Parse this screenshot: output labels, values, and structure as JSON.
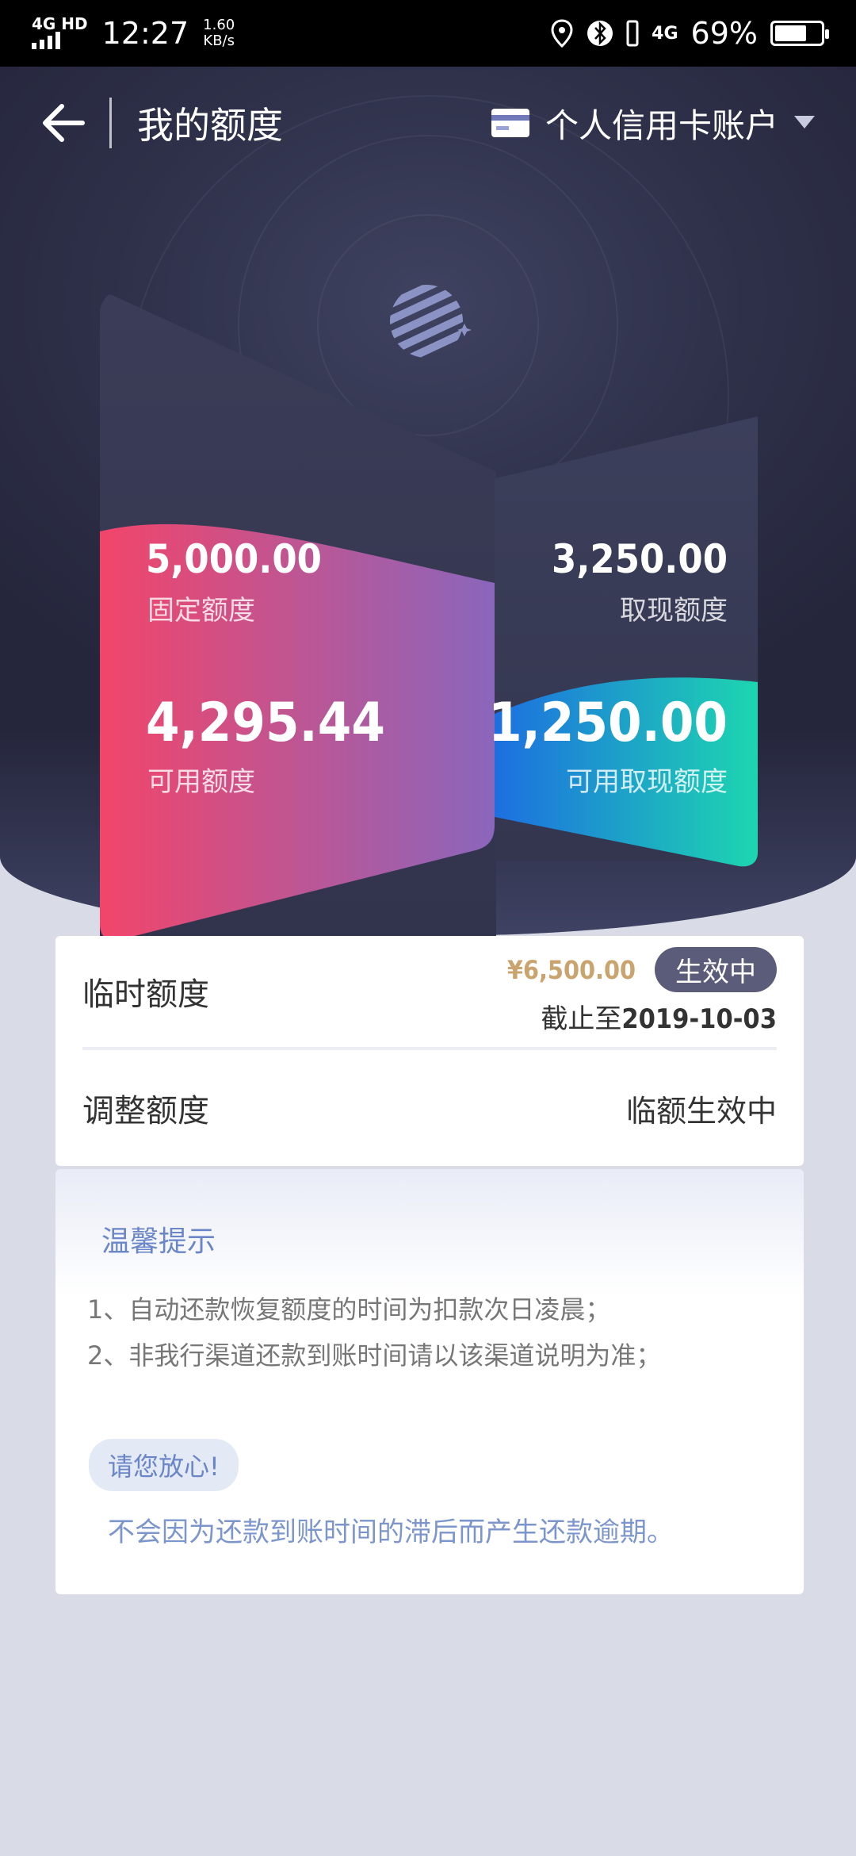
{
  "status_bar": {
    "network": "4G HD",
    "time": "12:27",
    "speed_value": "1.60",
    "speed_unit": "KB/s",
    "mobile": "4G",
    "battery_percent": "69%",
    "battery_level": 0.69
  },
  "nav": {
    "title": "我的额度",
    "account": "个人信用卡账户"
  },
  "limits": {
    "fixed": {
      "amount": "5,000.00",
      "label": "固定额度"
    },
    "available": {
      "amount": "4,295.44",
      "label": "可用额度"
    },
    "cash": {
      "amount": "3,250.00",
      "label": "取现额度"
    },
    "available_cash": {
      "amount": "1,250.00",
      "label": "可用取现额度"
    }
  },
  "temp_limit": {
    "label": "临时额度",
    "amount": "¥6,500.00",
    "status": "生效中",
    "until_prefix": "截止至",
    "until_date": "2019-10-03"
  },
  "adjust": {
    "label": "调整额度",
    "status": "临额生效中"
  },
  "tips": {
    "title": "温馨提示",
    "items": [
      "1、自动还款恢复额度的时间为扣款次日凌晨；",
      "2、非我行渠道还款到账时间请以该渠道说明为准；"
    ],
    "reassure_badge": "请您放心!",
    "reassure_text": "不会因为还款到账时间的滞后而产生还款逾期。"
  },
  "colors": {
    "hero_dark": "#2e3049",
    "pink": "#f2456a",
    "purple": "#8a66bc",
    "blue": "#1d7fe0",
    "teal": "#1dd6b0",
    "gold": "#c9a46e",
    "tip_blue": "#6b86c6"
  }
}
